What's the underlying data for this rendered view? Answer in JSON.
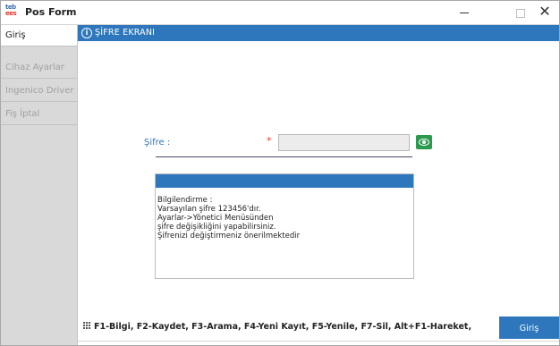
{
  "window": {
    "title": "Pos Form",
    "logo_top": "teb",
    "logo_bottom": "ees",
    "minimize_label": "–",
    "maximize_label": "☐",
    "close_label": "✕"
  },
  "sidebar": {
    "items": [
      {
        "label": "Giriş",
        "active": true
      },
      {
        "label": "Cihaz Ayarlar",
        "active": false
      },
      {
        "label": "Ingenico Driver",
        "active": false
      },
      {
        "label": "Fiş İptal",
        "active": false
      }
    ]
  },
  "main": {
    "header_title": "ŞİFRE EKRANI",
    "info_glyph": "i",
    "password_label": "Şifre :",
    "required_mark": "*",
    "password_value": "",
    "notice_lines": [
      "Bilgilendirme :",
      "Varsayılan şifre 123456'dır.",
      "Ayarlar->Yönetici Menüsünden",
      "şifre değişikliğini yapabilirsiniz.",
      "Şifrenizi değiştirmeniz önerilmektedir"
    ]
  },
  "footer": {
    "hotkeys": "F1-Bilgi, F2-Kaydet, F3-Arama, F4-Yeni Kayıt, F5-Yenile, F7-Sil, Alt+F1-Hareket,",
    "login_button": "Giriş"
  },
  "colors": {
    "accent": "#2e77bd",
    "required": "#e8382f",
    "eye_button": "#2a9a4c",
    "sidebar_bg": "#d9d9d9"
  },
  "icons": {
    "logo": "teb-logo",
    "info": "info-icon",
    "eye": "eye-icon",
    "grid": "grid-icon"
  }
}
